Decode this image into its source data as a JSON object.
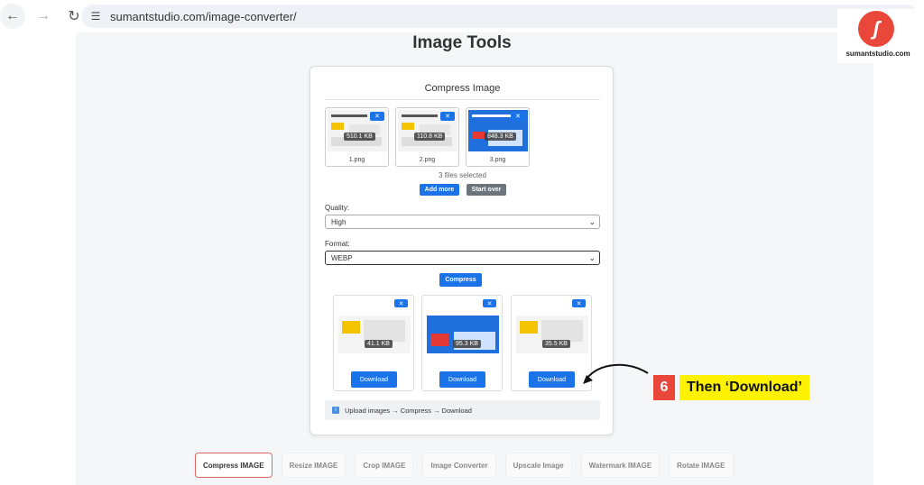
{
  "browser": {
    "url": "sumantstudio.com/image-converter/"
  },
  "brand": {
    "name": "sumantstudio.com"
  },
  "page": {
    "title": "Image Tools"
  },
  "card": {
    "title": "Compress Image",
    "thumbnails": [
      {
        "size": "510.1 KB",
        "name": "1.png"
      },
      {
        "size": "110.8 KB",
        "name": "2.png"
      },
      {
        "size": "848.3 KB",
        "name": "3.png"
      }
    ],
    "selected_text": "3 files selected",
    "add_more": "Add more",
    "start_over": "Start over",
    "quality_label": "Quality:",
    "quality_value": "High",
    "format_label": "Format:",
    "format_value": "WEBP",
    "compress": "Compress",
    "results": [
      {
        "size": "41.1 KB",
        "download": "Download"
      },
      {
        "size": "95.3 KB",
        "download": "Download"
      },
      {
        "size": "35.5 KB",
        "download": "Download"
      }
    ],
    "hint": "Upload images → Compress → Download"
  },
  "tabs": [
    "Compress IMAGE",
    "Resize IMAGE",
    "Crop IMAGE",
    "Image Converter",
    "Upscale Image",
    "Watermark IMAGE",
    "Rotate IMAGE"
  ],
  "callout": {
    "number": "6",
    "text": "Then ‘Download’"
  },
  "colors": {
    "accent": "#1a73e8",
    "brand": "#e8473a",
    "highlight": "#fff200"
  }
}
